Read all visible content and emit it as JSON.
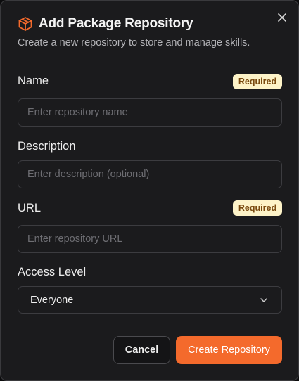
{
  "dialog": {
    "title": "Add Package Repository",
    "subtitle": "Create a new repository to store and manage skills.",
    "logo_icon": "package-cube-icon",
    "accent_color": "#f46a2c"
  },
  "fields": {
    "name": {
      "label": "Name",
      "badge": "Required",
      "placeholder": "Enter repository name"
    },
    "description": {
      "label": "Description",
      "placeholder": "Enter description (optional)"
    },
    "url": {
      "label": "URL",
      "badge": "Required",
      "placeholder": "Enter repository URL"
    },
    "access_level": {
      "label": "Access Level",
      "value": "Everyone"
    }
  },
  "actions": {
    "cancel_label": "Cancel",
    "create_label": "Create Repository"
  }
}
